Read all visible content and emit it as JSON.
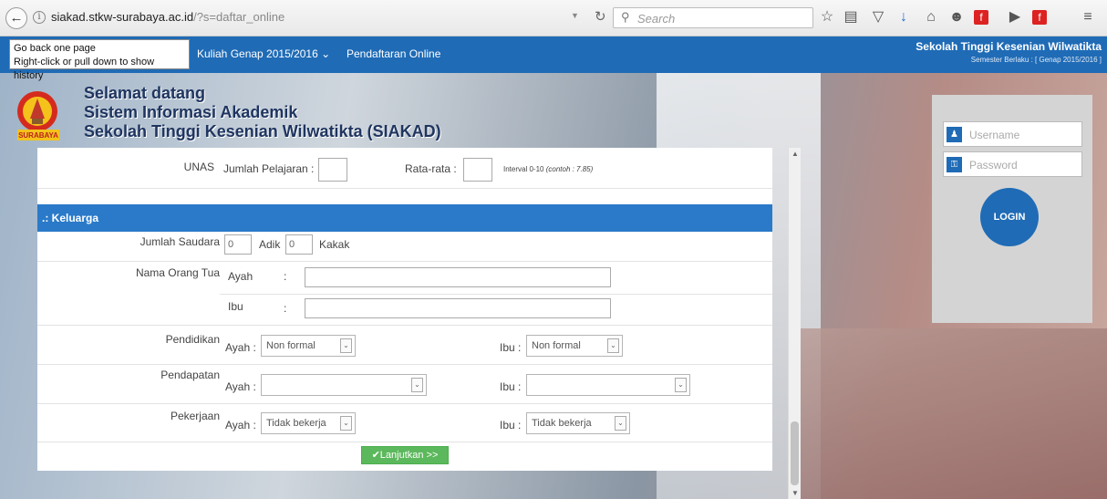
{
  "browser": {
    "url_host": "siakad.stkw-surabaya.ac.id",
    "url_path": "/?s=daftar_online",
    "search_placeholder": "Search",
    "tooltip_line1": "Go back one page",
    "tooltip_line2": "Right-click or pull down to show history"
  },
  "nav": {
    "menu_kuliah": "Kuliah Genap 2015/2016",
    "menu_pendaftaran": "Pendaftaran Online",
    "school_name": "Sekolah Tinggi Kesenian Wilwatikta",
    "semester": "Semester Berlaku : [ Genap 2015/2016 ]"
  },
  "header": {
    "logo_text": "SURABAYA",
    "line1": "Selamat datang",
    "line2": "Sistem Informasi Akademik",
    "line3": "Sekolah Tinggi Kesenian Wilwatikta (SIAKAD)"
  },
  "form": {
    "unas_label": "UNAS",
    "jumlah_pelajaran_label": "Jumlah Pelajaran :",
    "rata_rata_label": "Rata-rata :",
    "interval_hint": "Interval 0-10",
    "interval_example": "(contoh : 7.85)",
    "section_keluarga": ".: Keluarga",
    "jumlah_saudara_label": "Jumlah Saudara",
    "adik_value": "0",
    "adik_label": "Adik",
    "kakak_value": "0",
    "kakak_label": "Kakak",
    "nama_orang_tua_label": "Nama Orang Tua",
    "ayah_label": "Ayah",
    "ibu_label": "Ibu",
    "colon": ":",
    "pendidikan_label": "Pendidikan",
    "ayah_prefix": "Ayah :",
    "ibu_prefix": "Ibu :",
    "pendidikan_ayah": "Non formal",
    "pendidikan_ibu": "Non formal",
    "pendapatan_label": "Pendapatan",
    "pendapatan_ayah": "",
    "pendapatan_ibu": "",
    "pekerjaan_label": "Pekerjaan",
    "pekerjaan_ayah": "Tidak bekerja",
    "pekerjaan_ibu": "Tidak bekerja",
    "next_button": "Lanjutkan >>"
  },
  "login": {
    "username_placeholder": "Username",
    "password_placeholder": "Password",
    "button": "LOGIN"
  },
  "colors": {
    "brand_blue": "#1f6bb6",
    "section_blue": "#2a7ac9",
    "button_green": "#5cb85c"
  }
}
